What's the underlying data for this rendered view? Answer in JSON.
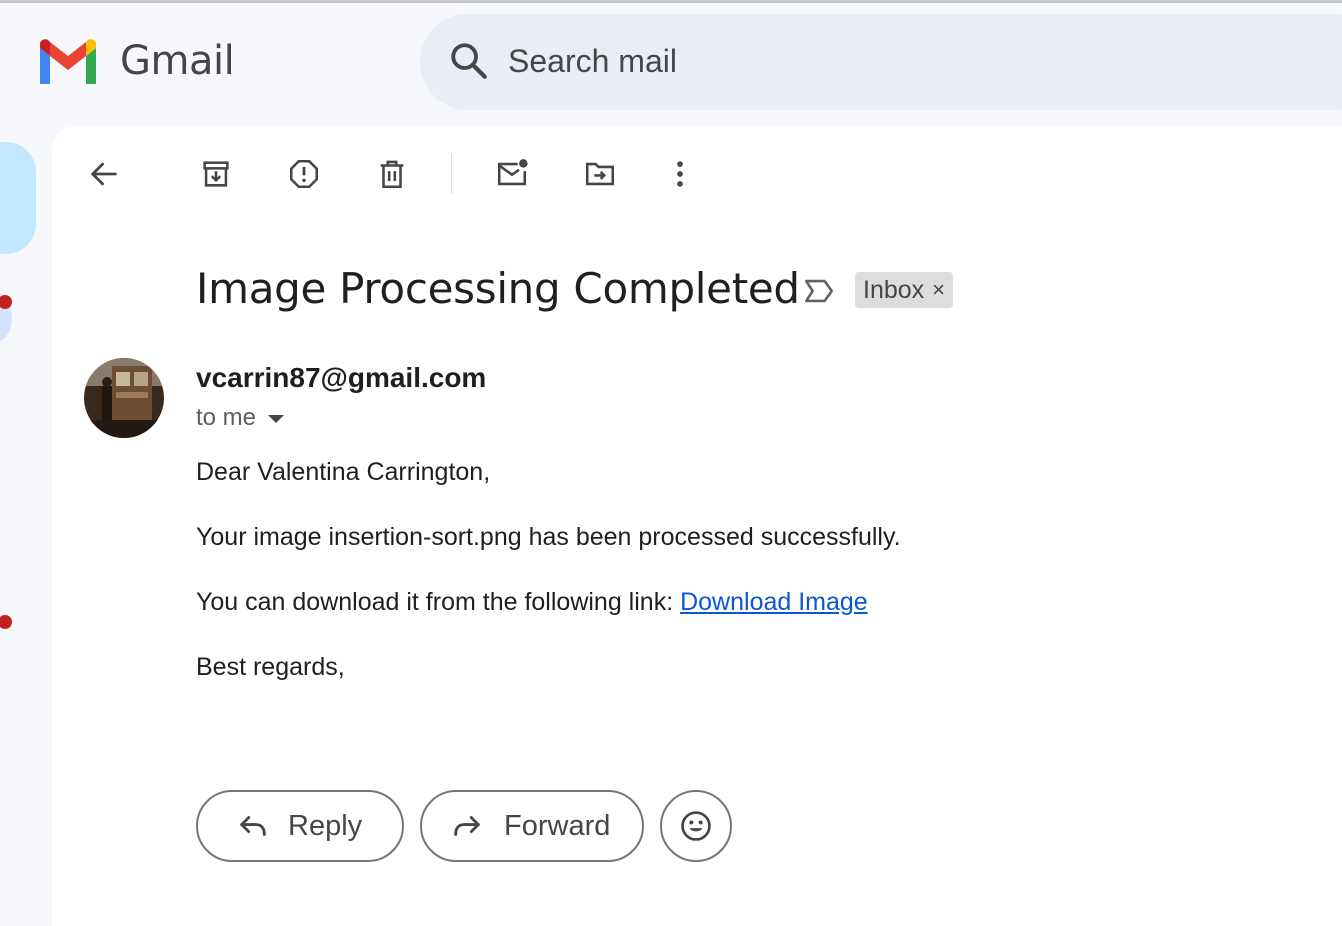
{
  "app": {
    "brand": "Gmail"
  },
  "search": {
    "placeholder": "Search mail"
  },
  "toolbar": {
    "items": [
      "back-icon",
      "archive-icon",
      "report-spam-icon",
      "delete-icon",
      "mark-unread-icon",
      "move-to-icon",
      "more-options-icon"
    ]
  },
  "email": {
    "subject": "Image Processing Completed",
    "label": "Inbox",
    "label_remove": "×",
    "sender": "vcarrin87@gmail.com",
    "recipients": "to me",
    "greeting": "Dear Valentina Carrington,",
    "line1": "Your image insertion-sort.png has been processed successfully.",
    "line2_prefix": "You can download it from the following link: ",
    "link_text": "Download Image",
    "signoff": "Best regards,"
  },
  "actions": {
    "reply_label": "Reply",
    "forward_label": "Forward"
  },
  "colors": {
    "accent_blue": "#0b57d0",
    "search_bg": "#e9eef6",
    "nav_active": "#c2e7ff",
    "unread_dot": "#c5221f"
  }
}
